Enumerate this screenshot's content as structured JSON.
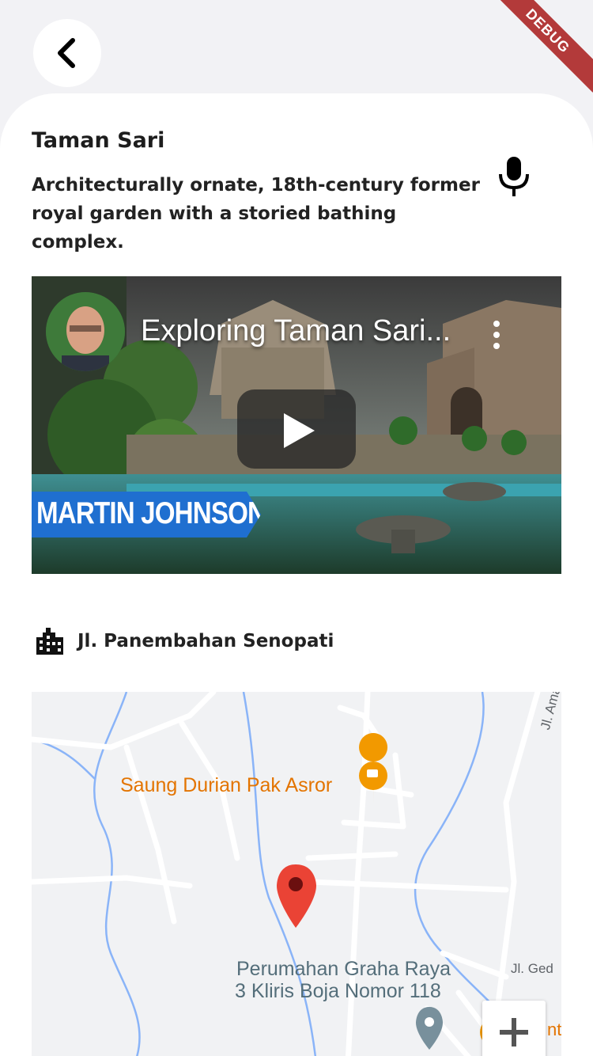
{
  "debug_banner": "DEBUG",
  "place": {
    "title": "Taman Sari",
    "description": "Architecturally ornate, 18th-century former royal garden with a storied bathing complex."
  },
  "video": {
    "title": "Exploring Taman Sari...",
    "channel_tag": "MARTIN JOHNSON"
  },
  "address": {
    "street": "Jl. Panembahan Senopati"
  },
  "map": {
    "labels": {
      "cafe": "Saung Durian Pak Asror",
      "road_amarta": "Jl. Amarta",
      "housing_line1": "Perumahan Graha Raya",
      "housing_line2": "3 Kliris Boja Nomor 118",
      "road_ged": "Jl. Ged",
      "partial_right": "nti"
    },
    "colors": {
      "water": "#8ab4f8",
      "road": "#ffffff",
      "poi_orange": "#f29900",
      "pin_red": "#ea4335",
      "pin_gray": "#78909c"
    }
  },
  "icons": {
    "back": "chevron-left-icon",
    "mic": "microphone-icon",
    "building": "building-icon",
    "play": "play-icon",
    "zoom_in": "plus-icon"
  }
}
